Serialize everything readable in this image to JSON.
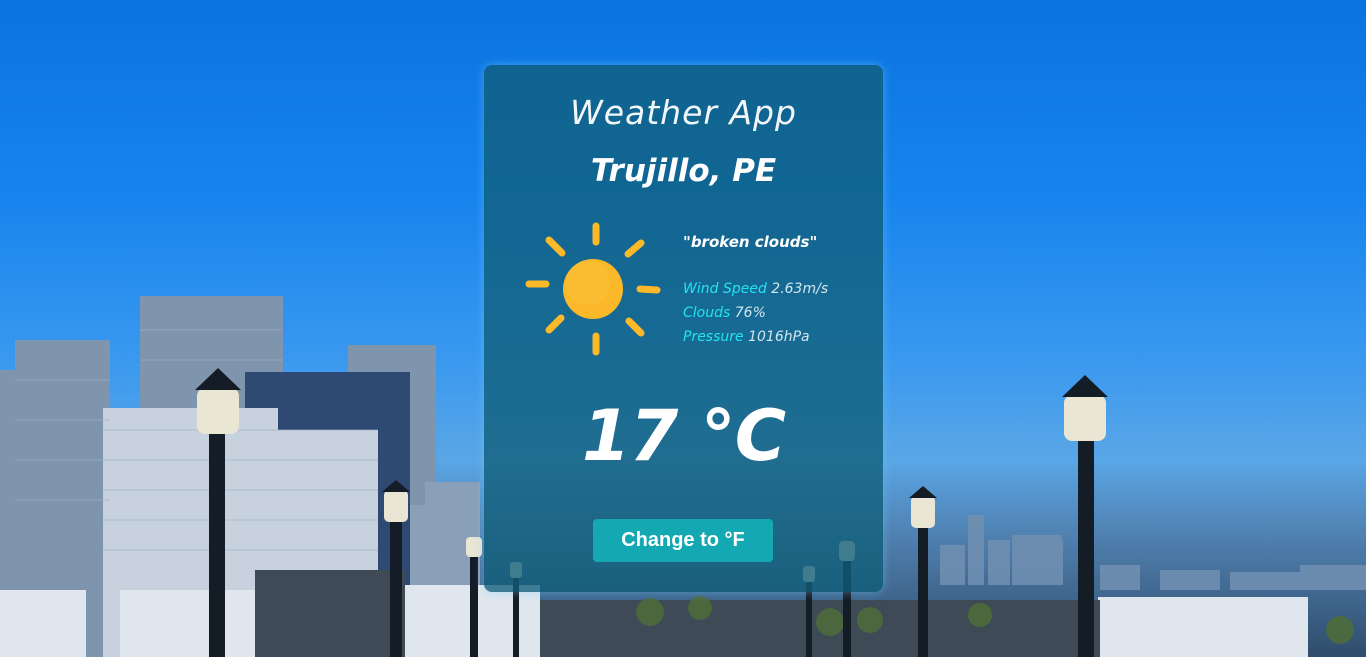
{
  "app": {
    "title": "Weather App"
  },
  "location": {
    "city": "Trujillo, PE"
  },
  "weather": {
    "icon": "sun-icon",
    "description": "\"broken clouds\"",
    "details": [
      {
        "label": "Wind Speed",
        "value": "2.63m/s"
      },
      {
        "label": "Clouds",
        "value": "76%"
      },
      {
        "label": "Pressure",
        "value": "1016hPa"
      }
    ],
    "temperature": "17 °C"
  },
  "controls": {
    "toggle_unit_label": "Change to °F"
  },
  "colors": {
    "card_background": "#105e78",
    "detail_label": "#21e4f0",
    "button": "#14a8b2",
    "sun": "#fbb829"
  }
}
